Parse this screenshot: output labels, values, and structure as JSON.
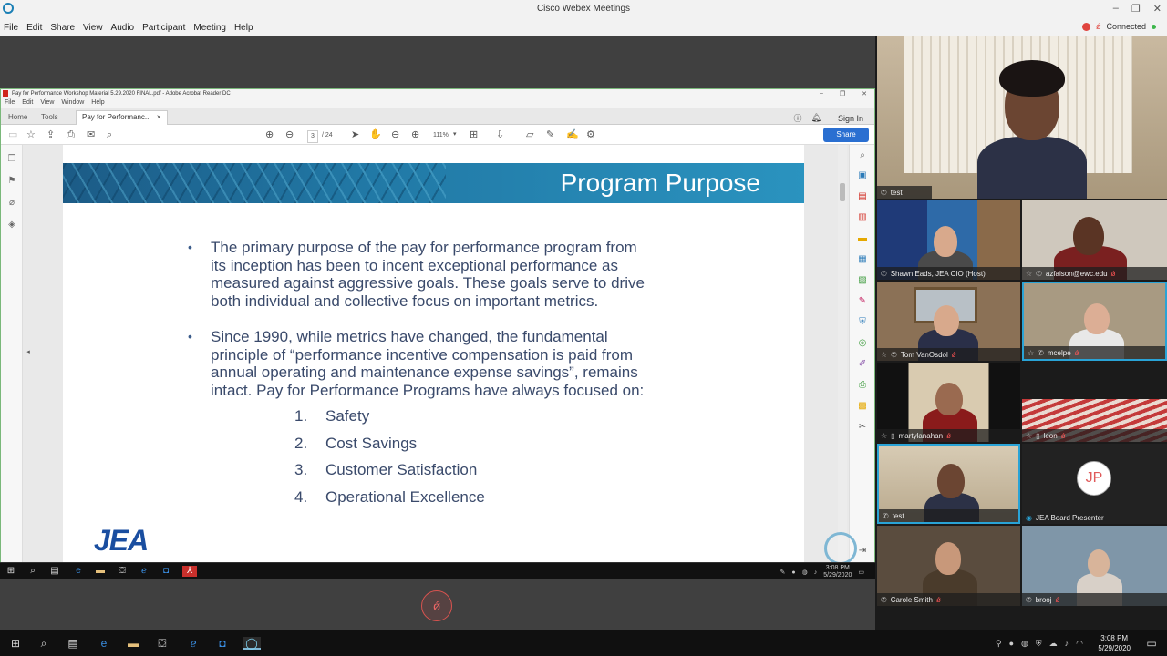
{
  "window": {
    "title": "Cisco Webex Meetings",
    "min": "–",
    "max": "❐",
    "close": "✕"
  },
  "menubar": {
    "items": [
      "File",
      "Edit",
      "Share",
      "View",
      "Audio",
      "Participant",
      "Meeting",
      "Help"
    ],
    "status": "Connected"
  },
  "acrobat": {
    "title": "Pay for Performance Workshop Material 5.29.2020 FINAL.pdf - Adobe Acrobat Reader DC",
    "menu": [
      "File",
      "Edit",
      "View",
      "Window",
      "Help"
    ],
    "tabs": {
      "home": "Home",
      "tools": "Tools",
      "doc": "Pay for Performanc...",
      "close": "×"
    },
    "sign_in": "Sign In",
    "page_current": "3",
    "page_total": "/ 24",
    "zoom": "111%",
    "share_label": "Share"
  },
  "slide": {
    "title": "Program Purpose",
    "bullet1": [
      "The primary purpose of the pay for performance program from",
      "its inception has been to incent exceptional performance as",
      "measured against aggressive goals. These goals serve to drive",
      "both individual and collective focus on important metrics."
    ],
    "bullet2": [
      "Since 1990, while metrics have changed, the fundamental",
      "principle of “performance incentive compensation is paid from",
      "annual operating and maintenance expense savings”, remains",
      "intact.  Pay for Performance Programs have always focused on:"
    ],
    "list": [
      {
        "n": "1.",
        "t": "Safety"
      },
      {
        "n": "2.",
        "t": "Cost Savings"
      },
      {
        "n": "3.",
        "t": "Customer Satisfaction"
      },
      {
        "n": "4.",
        "t": "Operational Excellence"
      }
    ],
    "logo": "JEA"
  },
  "inner_clock": {
    "time": "3:08 PM",
    "date": "5/29/2020"
  },
  "participants": {
    "main": "test",
    "tiles": [
      {
        "name": "Shawn Eads, JEA CIO (Host)"
      },
      {
        "name": "azfaison@ewc.edu"
      },
      {
        "name": "Tom VanOsdol"
      },
      {
        "name": "mcelpe"
      },
      {
        "name": "martylanahan"
      },
      {
        "name": "leon"
      },
      {
        "name": "test"
      },
      {
        "name": "JEA Board Presenter",
        "initials": "JP"
      },
      {
        "name": "Carole Smith"
      },
      {
        "name": "brooj"
      }
    ]
  },
  "taskbar": {
    "time": "3:08 PM",
    "date": "5/29/2020"
  },
  "colors": {
    "accent": "#2a6fd1",
    "banner": "#2178a5",
    "slide_text": "#3a4a6b",
    "selected": "#29a3d6"
  }
}
